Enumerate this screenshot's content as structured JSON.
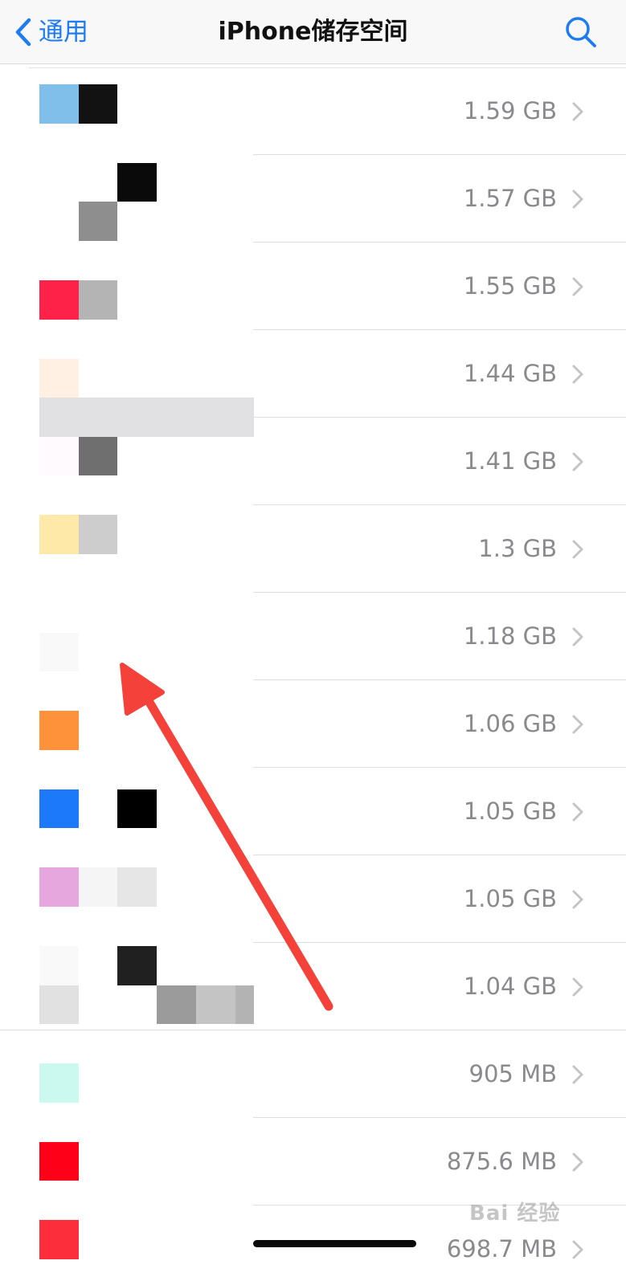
{
  "navbar": {
    "back_label": "通用",
    "title": "iPhone储存空间",
    "accent_color": "#1e7cf2",
    "back_icon": "chevron-left-icon",
    "search_icon": "search-icon"
  },
  "rows": [
    {
      "size": "1.59 GB"
    },
    {
      "size": "1.57 GB"
    },
    {
      "size": "1.55 GB"
    },
    {
      "size": "1.44 GB"
    },
    {
      "size": "1.41 GB"
    },
    {
      "size": "1.3 GB"
    },
    {
      "size": "1.18 GB"
    },
    {
      "size": "1.06 GB"
    },
    {
      "size": "1.05 GB"
    },
    {
      "size": "1.05 GB"
    },
    {
      "size": "1.04 GB"
    },
    {
      "size": "905 MB"
    },
    {
      "size": "875.6 MB"
    },
    {
      "size": "698.7 MB"
    }
  ],
  "annotation": {
    "arrow_color": "#f4413a",
    "arrow_icon": "red-arrow-annotation"
  },
  "watermark": {
    "text": "Bai 经验"
  }
}
